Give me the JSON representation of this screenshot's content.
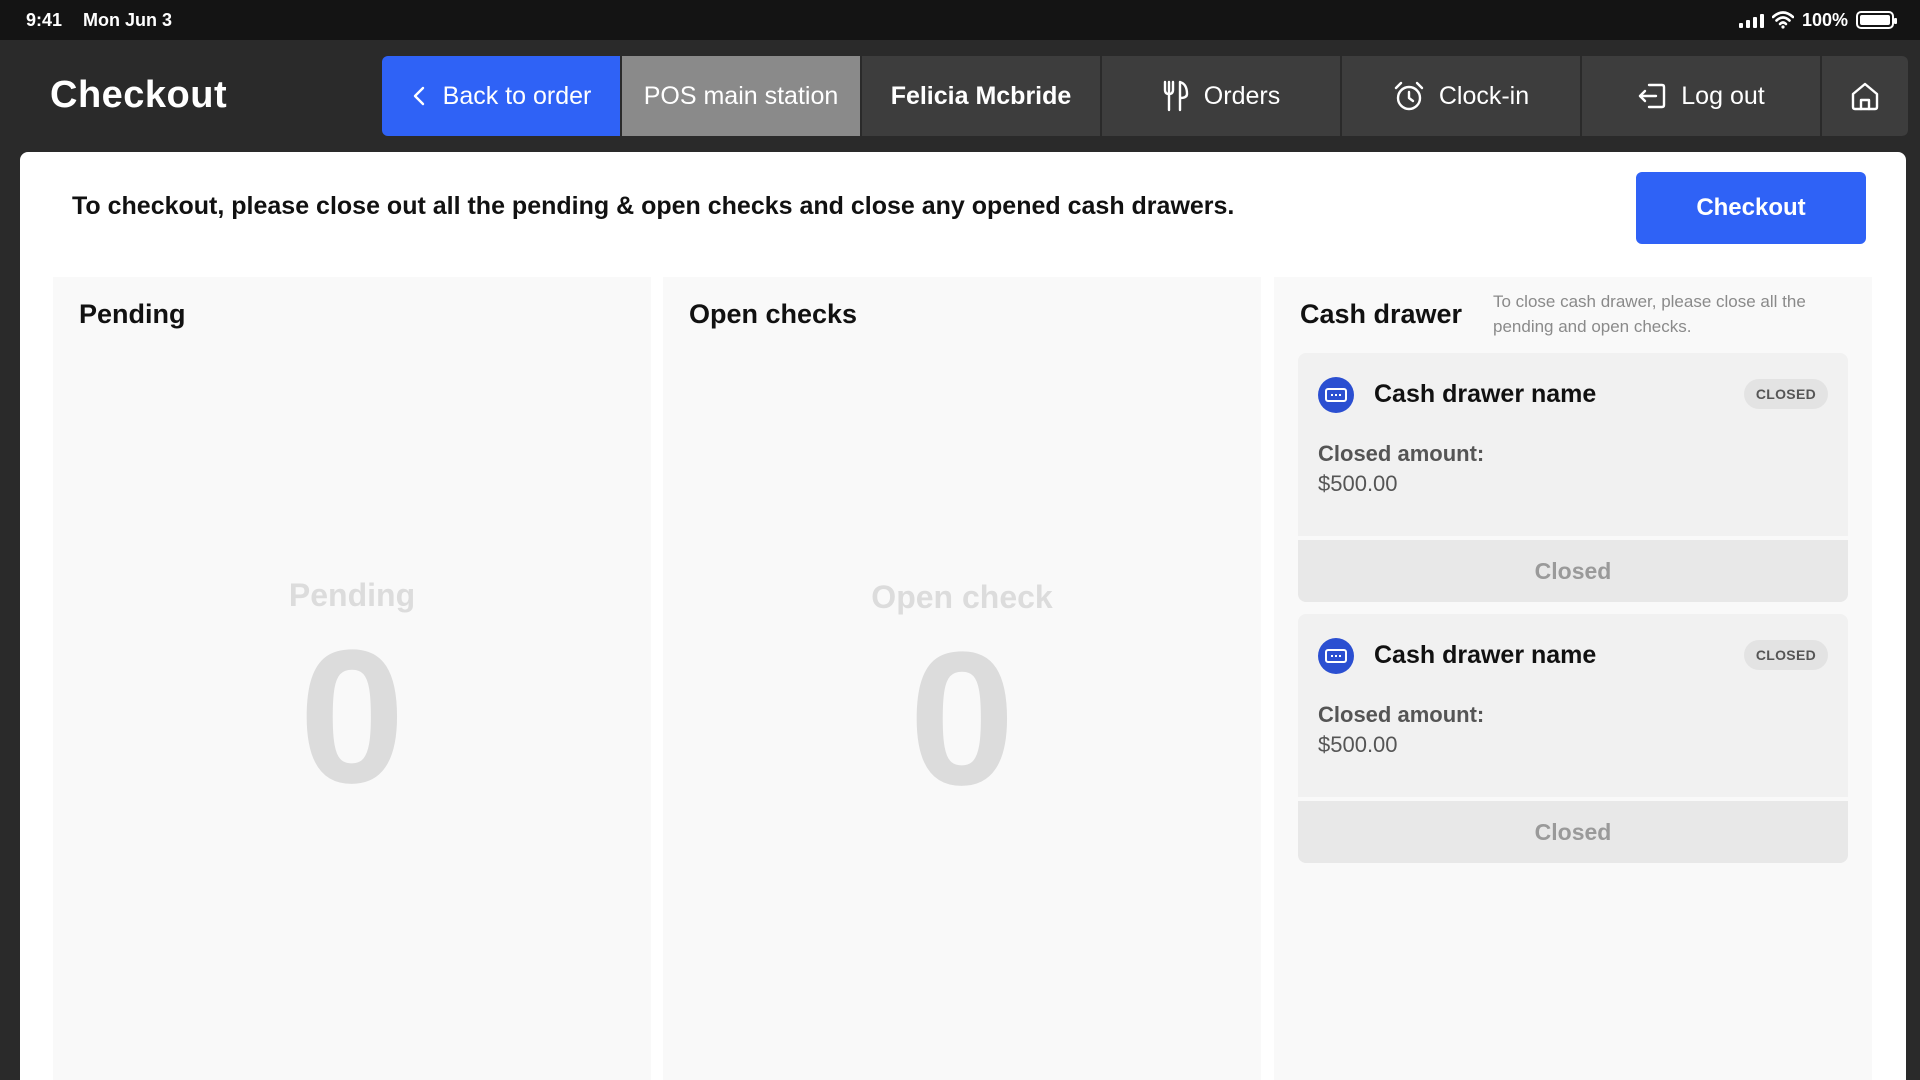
{
  "status_bar": {
    "time": "9:41",
    "date": "Mon Jun 3",
    "battery": "100%"
  },
  "header": {
    "title": "Checkout",
    "nav": {
      "back": "Back to order",
      "station": "POS main station",
      "user": "Felicia Mcbride",
      "orders": "Orders",
      "clock_in": "Clock-in",
      "log_out": "Log out"
    }
  },
  "main": {
    "instructions": "To checkout, please close out all the pending & open checks and close any opened cash drawers.",
    "checkout_label": "Checkout",
    "pending": {
      "title": "Pending",
      "empty_label": "Pending",
      "count": "0"
    },
    "open_checks": {
      "title": "Open checks",
      "empty_label": "Open check",
      "count": "0"
    },
    "cash_drawer": {
      "title": "Cash drawer",
      "note": "To close cash drawer, please close all the pending and open checks.",
      "drawers": [
        {
          "name": "Cash drawer name",
          "badge": "CLOSED",
          "amount_label": "Closed amount:",
          "amount": "$500.00",
          "button_label": "Closed"
        },
        {
          "name": "Cash drawer name",
          "badge": "CLOSED",
          "amount_label": "Closed amount:",
          "amount": "$500.00",
          "button_label": "Closed"
        }
      ]
    }
  },
  "colors": {
    "accent": "#2f62f6",
    "header_bg": "#2a2a2a",
    "station_bg": "#8a8a8a",
    "drawer_icon": "#2b4fd1"
  }
}
